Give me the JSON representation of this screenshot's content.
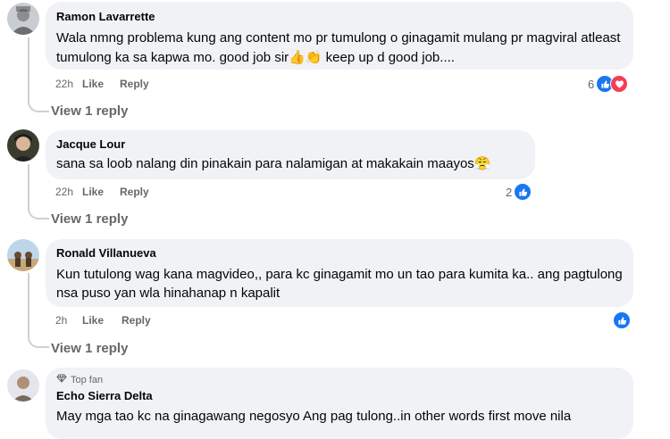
{
  "comments": [
    {
      "author": "Ramon Lavarrette",
      "text": "Wala nmng problema kung ang content mo pr tumulong o ginagamit mulang pr magviral atleast tumulong ka sa kapwa mo. good job sir👍👏 keep up d good job....",
      "time": "22h",
      "like_label": "Like",
      "reply_label": "Reply",
      "reaction_count": "6",
      "reactions": [
        "like-icon",
        "love-icon"
      ],
      "view_replies": "View 1 reply"
    },
    {
      "author": "Jacque Lour",
      "text": "sana sa loob nalang din pinakain para nalamigan at makakain maayos😤",
      "time": "22h",
      "like_label": "Like",
      "reply_label": "Reply",
      "reaction_count": "2",
      "reactions": [
        "like-icon"
      ],
      "view_replies": "View 1 reply"
    },
    {
      "author": "Ronald Villanueva",
      "text": "Kun tutulong wag kana magvideo,, para kc ginagamit mo un tao para kumita ka.. ang pagtulong nsa puso yan wla hinahanap n kapalit",
      "time": "2h",
      "like_label": "Like",
      "reply_label": "Reply",
      "reaction_count": "",
      "reactions": [
        "like-icon"
      ],
      "view_replies": "View 1 reply"
    },
    {
      "badge": "Top fan",
      "author": "Echo Sierra Delta",
      "text": "May mga tao kc na ginagawang negosyo Ang pag tulong..in other words first move nila"
    }
  ],
  "colors": {
    "bubble": "#f0f2f5",
    "meta": "#65676b",
    "like_blue": "#1877f2",
    "love_red": "#f33e58"
  }
}
